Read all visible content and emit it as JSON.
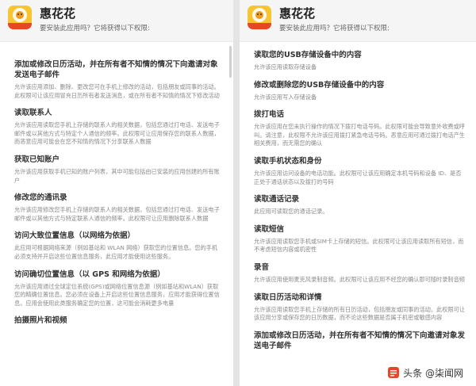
{
  "app": {
    "name": "惠花花",
    "badge_text": "分期分期",
    "subtitle": "要安装此应用吗？它将获得以下权限:"
  },
  "left_permissions": [
    {
      "title": "添加或修改日历活动，并在所有者不知情的情况下向邀请对象发送电子邮件",
      "desc": "允许该应用添加、删除、更改您可在手机上修改的活动，包括朋友或同事的活动。此权限可让该应用冒充日历所有者发送消息，或在所有者不知情的情况下修改活动"
    },
    {
      "title": "读取联系人",
      "desc": "允许该应用读取您手机上存储的联系人的相关数据，包括您通过打电话、发送电子邮件或以其他方式与特定个人通信的频率。此权限可让应用保存您的联系人数据，而恶意应用可能会在您不知情的情况下分享联系人数据"
    },
    {
      "title": "获取已知账户",
      "desc": "允许该应用获取手机已知的账户列表，其中可能包括由已安装的应用创建的所有账户"
    },
    {
      "title": "修改您的通讯录",
      "desc": "允许该应用修改您手机上存储的联系人的相关数据，包括您通过打电话、发送电子邮件或以其他方式与特定联系人通信的频率。此权限可让应用删除联系人数据"
    },
    {
      "title": "访问大致位置信息（以网络为依据）",
      "desc": "此应用可根据网络来源（例如基站和 WLAN 网络）获取您的位置信息。您的手机必须支持并开启这些位置信息服务，此应用才能使用这些服务。"
    },
    {
      "title": "访问确切位置信息（以 GPS 和网络为依据）",
      "desc": "允许该应用通过全球定位系统(GPS)或网络位置信息源（例如基站和WLAN）获取您的精确位置信息。您必须在设备上开启这些位置信息服务，应用才能获得位置信息。应用会使用此类服务确定您的位置，这可能会消耗更多电量"
    },
    {
      "title": "拍摄照片和视频",
      "desc": ""
    }
  ],
  "right_permissions": [
    {
      "title": "读取您的USB存储设备中的内容",
      "desc": "允许该应用读取存储设备"
    },
    {
      "title": "修改或删除您的USB存储设备中的内容",
      "desc": "允许该应用写入存储设备"
    },
    {
      "title": "拨打电话",
      "desc": "允许该应用在您未执行操作的情况下拨打电话号码。此权限可能会导致意外收费或呼叫。请注意，此权限不允许该应用拨打紧急电话号码。恶意应用可通过拨打电话产生相关费用，而无需您的确认"
    },
    {
      "title": "读取手机状态和身份",
      "desc": "允许该应用访问设备的电话功能。此权限可让该应用确定本机号码和设备 ID、是否正处于通话状态以及拨打的号码"
    },
    {
      "title": "读取通话记录",
      "desc": "此应用可读取您的通话记录。"
    },
    {
      "title": "读取短信",
      "desc": "允许该应用读取您手机或SIM卡上存储的短信。此权限可让该应用读取所有短信，而不考虑短信内容或机密性"
    },
    {
      "title": "录音",
      "desc": "允许该应用使用麦克风录制音频。此权限可让该应用不经您的确认即可随时录制音频"
    },
    {
      "title": "读取日历活动和详情",
      "desc": "允许该应用读取您手机上存储的所有日历活动，包括朋友或同事的活动。此权限可让该应用分享或保存您的日历数据，而不论这些数据是否属于机密或敏感内容"
    },
    {
      "title": "添加或修改日历活动，并在所有者不知情的情况下向邀请对象发送电子邮件",
      "desc": ""
    }
  ],
  "watermark": {
    "text": "头条 @柒闻网"
  },
  "colors": {
    "icon_yellow": "#f7c531",
    "title_text": "#333333",
    "desc_text": "#8a8a8a"
  }
}
